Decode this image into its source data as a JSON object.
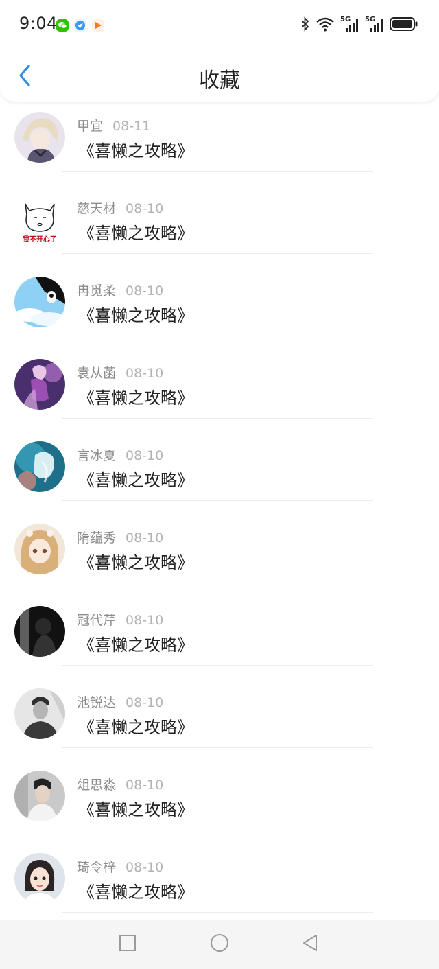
{
  "status_bar": {
    "time": "9:04",
    "app_icons": [
      "wechat-icon",
      "browser-icon",
      "video-icon"
    ],
    "indicators": [
      "bluetooth-icon",
      "wifi-icon",
      "signal-5g-icon",
      "signal-5g-icon",
      "battery-icon"
    ],
    "network_label_1": "5G",
    "network_label_2": "5G"
  },
  "header": {
    "back_icon": "chevron-left-icon",
    "title": "收藏",
    "accent_color": "#2f8be6"
  },
  "favorites": [
    {
      "name": "甲宜",
      "date": "08-11",
      "title": "《喜懒之攻略》"
    },
    {
      "name": "慈天材",
      "date": "08-10",
      "title": "《喜懒之攻略》",
      "avatar_caption": "我不开心了"
    },
    {
      "name": "冉觅柔",
      "date": "08-10",
      "title": "《喜懒之攻略》"
    },
    {
      "name": "袁从菡",
      "date": "08-10",
      "title": "《喜懒之攻略》"
    },
    {
      "name": "言冰夏",
      "date": "08-10",
      "title": "《喜懒之攻略》"
    },
    {
      "name": "隋蕴秀",
      "date": "08-10",
      "title": "《喜懒之攻略》"
    },
    {
      "name": "冠代芹",
      "date": "08-10",
      "title": "《喜懒之攻略》"
    },
    {
      "name": "池锐达",
      "date": "08-10",
      "title": "《喜懒之攻略》"
    },
    {
      "name": "俎思淼",
      "date": "08-10",
      "title": "《喜懒之攻略》"
    },
    {
      "name": "琦令梓",
      "date": "08-10",
      "title": "《喜懒之攻略》"
    }
  ],
  "system_nav": {
    "recents_icon": "square-icon",
    "home_icon": "circle-icon",
    "back_icon": "triangle-back-icon"
  }
}
